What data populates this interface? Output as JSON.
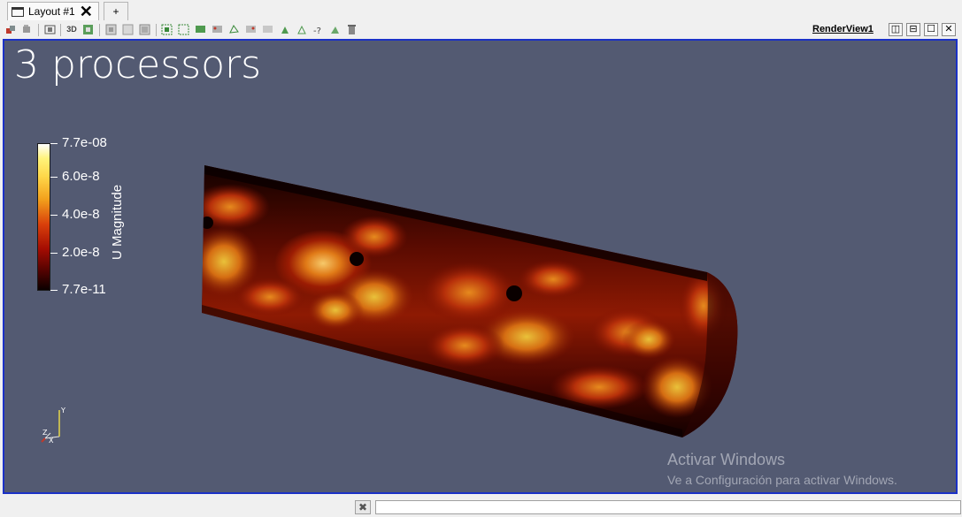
{
  "tabs": {
    "layout_label": "Layout #1",
    "close_glyph": "✕",
    "add_label": "+"
  },
  "toolbar": {
    "mode_3d_label": "3D",
    "view_name": "RenderView1",
    "icons": [
      "camera-link-icon",
      "camera-undo-icon",
      "capture-icon",
      "3d-toggle-icon",
      "interaction-mode-icon",
      "select-surface-cells-icon",
      "select-surface-points-icon",
      "select-frustum-cells-icon",
      "select-frustum-points-icon",
      "select-block-icon",
      "interactive-select-cells-icon",
      "interactive-select-points-icon",
      "select-polygon-icon",
      "hover-points-icon",
      "hover-cells-icon",
      "grow-selection-icon",
      "shrink-selection-icon",
      "query-selection-icon",
      "extract-selection-icon",
      "clear-selection-icon"
    ]
  },
  "view_controls": {
    "split_h": "◫",
    "split_v": "⊟",
    "maximize": "☐",
    "close": "✕"
  },
  "render": {
    "title": "3 processors",
    "colors": {
      "background": "#535a72",
      "frame_border": "#1b31c6",
      "text": "#ffffff"
    }
  },
  "colorbar": {
    "title": "U Magnitude",
    "labels": [
      "7.7e-08",
      "6.0e-8",
      "4.0e-8",
      "2.0e-8",
      "7.7e-11"
    ],
    "colormap": "black-body-radiation"
  },
  "axes": {
    "x": "X",
    "y": "Y",
    "z": "Z"
  },
  "watermark": {
    "title": "Activar Windows",
    "subtitle": "Ve a Configuración para activar Windows."
  },
  "bottom": {
    "close_glyph": "✖"
  }
}
